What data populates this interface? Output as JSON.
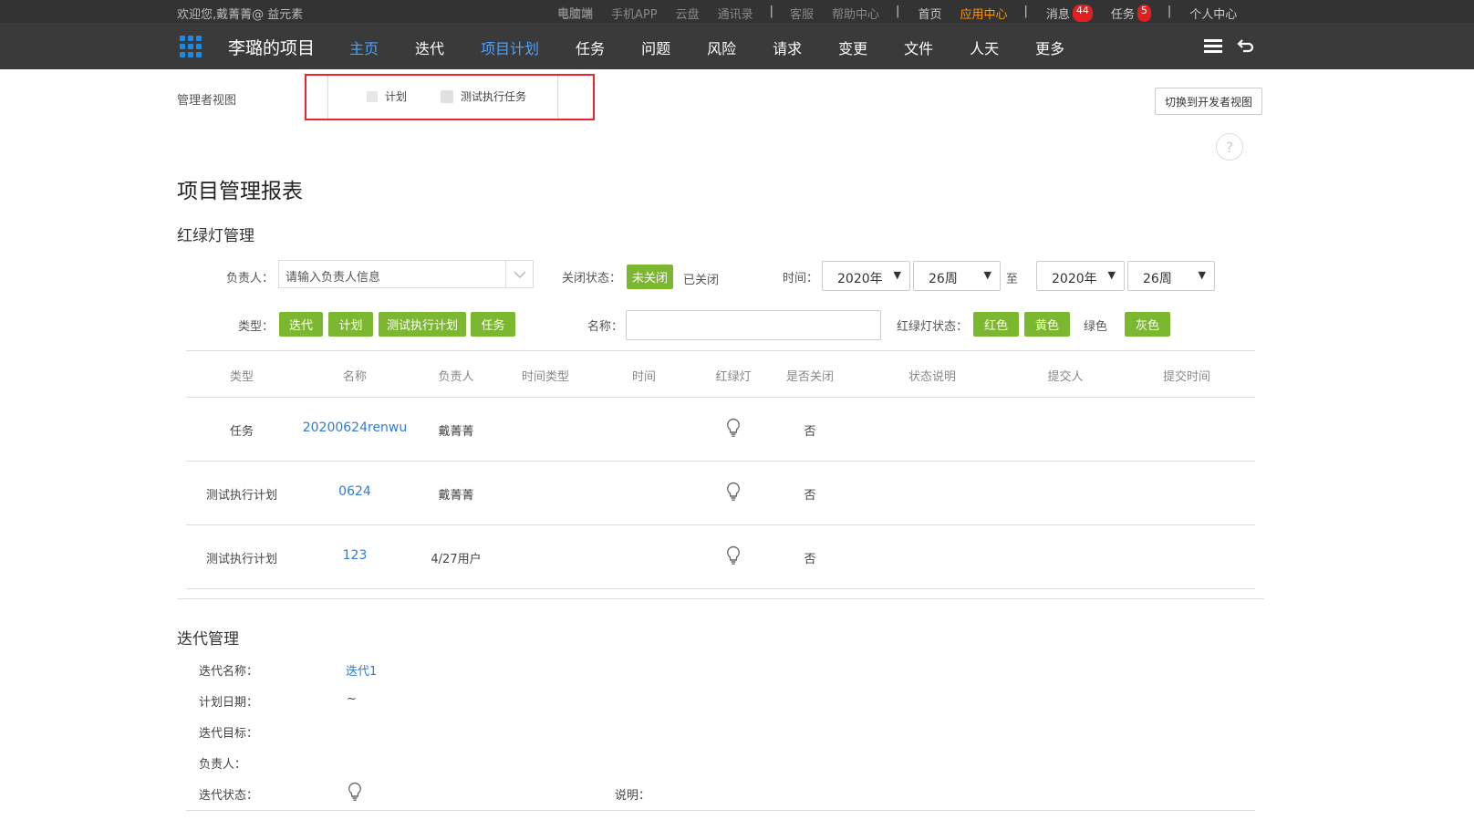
{
  "topbar": {
    "welcome": "欢迎您,戴菁菁@ 益元素",
    "links": [
      "电脑端",
      "手机APP",
      "云盘",
      "通讯录",
      "|",
      "客服",
      "帮助中心",
      "|"
    ],
    "home": "首页",
    "app_center": "应用中心",
    "messages": "消息",
    "messages_count": "44",
    "tasks": "任务",
    "tasks_count": "5",
    "personal": "个人中心"
  },
  "nav": {
    "project_title": "李璐的项目",
    "items": [
      "主页",
      "迭代",
      "项目计划",
      "任务",
      "问题",
      "风险",
      "请求",
      "变更",
      "文件",
      "人天",
      "更多"
    ],
    "active_index": 2
  },
  "subheader": {
    "manager_view": "管理者视图",
    "tabs": [
      "计划",
      "测试执行任务"
    ],
    "switch_button": "切换到开发者视图",
    "help": "?"
  },
  "page": {
    "title": "项目管理报表",
    "section_traffic": "红绿灯管理",
    "section_iteration": "迭代管理"
  },
  "filters": {
    "owner_label": "负责人：",
    "owner_placeholder": "请输入负责人信息",
    "close_status_label": "关闭状态：",
    "close_status_selected": "未关闭",
    "close_status_other": "已关闭",
    "time_label": "时间：",
    "from_year": "2020年",
    "from_week": "26周",
    "to_label": "至",
    "to_year": "2020年",
    "to_week": "26周",
    "type_label": "类型：",
    "types": [
      "迭代",
      "计划",
      "测试执行计划",
      "任务"
    ],
    "name_label": "名称：",
    "light_status_label": "红绿灯状态：",
    "light_red": "红色",
    "light_yellow": "黄色",
    "light_green": "绿色",
    "light_gray": "灰色"
  },
  "table": {
    "headers": [
      "类型",
      "名称",
      "负责人",
      "时间类型",
      "时间",
      "红绿灯",
      "是否关闭",
      "状态说明",
      "提交人",
      "提交时间"
    ],
    "rows": [
      {
        "type": "任务",
        "name": "20200624renwu",
        "owner": "戴菁菁",
        "closed": "否"
      },
      {
        "type": "测试执行计划",
        "name": "0624",
        "owner": "戴菁菁",
        "closed": "否"
      },
      {
        "type": "测试执行计划",
        "name": "123",
        "owner": "4/27用户",
        "closed": "否"
      }
    ]
  },
  "iteration": {
    "name_label": "迭代名称：",
    "name_value": "迭代1",
    "date_label": "计划日期：",
    "date_value": "~",
    "goal_label": "迭代目标：",
    "owner_label": "负责人：",
    "status_label": "迭代状态：",
    "note_label": "说明："
  },
  "colors": {
    "accent_green": "#7cb82f",
    "link_blue": "#2f7bd6",
    "highlight_red": "#e8242c",
    "nav_active": "#4aa3ff",
    "app_center": "#ff9800"
  }
}
